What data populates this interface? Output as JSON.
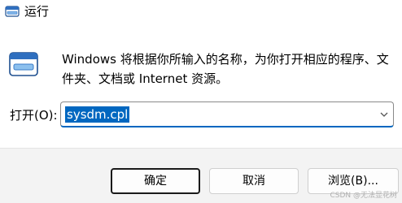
{
  "window": {
    "title": "运行",
    "icon": "run-icon"
  },
  "body": {
    "icon": "run-icon",
    "message": "Windows 将根据你所输入的名称，为你打开相应的程序、文件夹、文档或 Internet 资源。"
  },
  "open": {
    "label": "打开(O):",
    "value": "sysdm.cpl",
    "dropdown_icon": "chevron-down-icon"
  },
  "buttons": {
    "ok": "确定",
    "cancel": "取消",
    "browse": "浏览(B)..."
  },
  "watermark": "CSDN @无法显花树",
  "colors": {
    "accent": "#0067c0",
    "footer_bg": "#f3f3f3"
  }
}
